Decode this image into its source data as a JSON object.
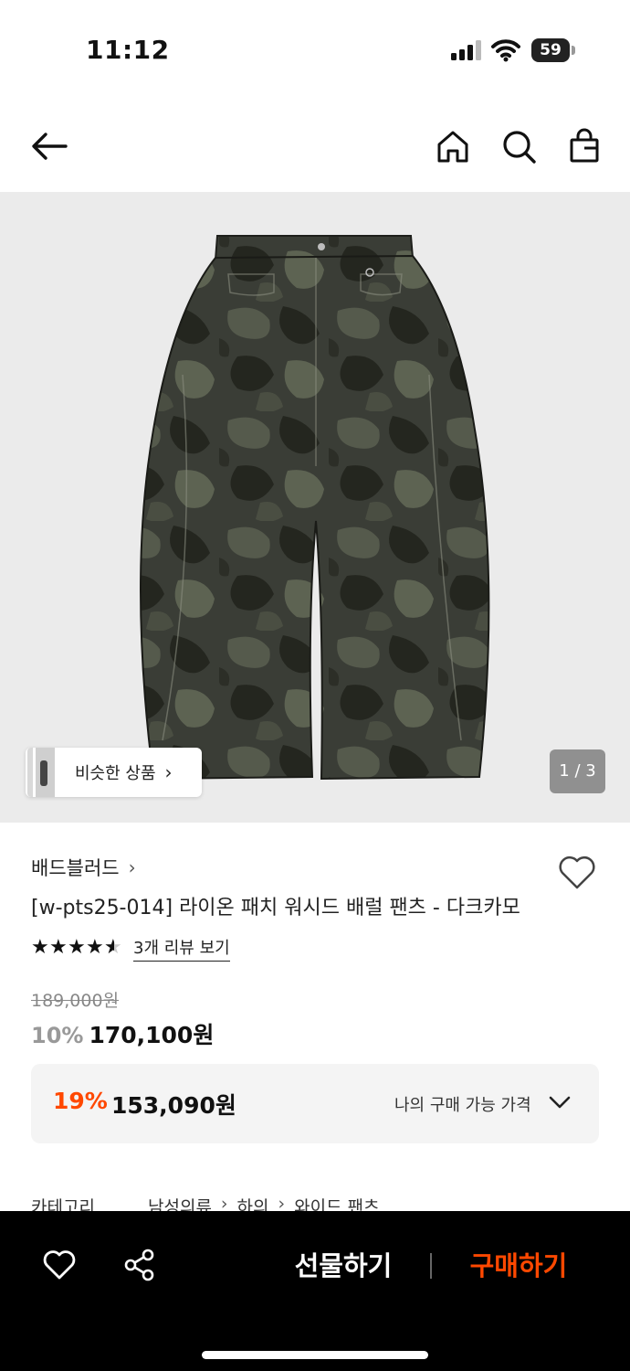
{
  "status_bar": {
    "time": "11:12",
    "battery": "59"
  },
  "nav": {
    "back_icon": "arrow-left-icon",
    "home_icon": "home-icon",
    "search_icon": "search-icon",
    "bag_icon": "shopping-bag-icon"
  },
  "gallery": {
    "similar_label": "비슷한 상품",
    "counter": "1 / 3"
  },
  "product": {
    "brand": "배드블러드",
    "title": "[w-pts25-014] 라이온 패치 워시드 배럴 팬츠 - 다크카모",
    "rating": 4.5,
    "review_link": "3개 리뷰 보기",
    "original_price": "189,000원",
    "discount_percent": "10%",
    "sale_price": "170,100원",
    "my_price": {
      "percent": "19%",
      "price": "153,090원",
      "label": "나의 구매 가능 가격"
    },
    "category": {
      "label": "카테고리",
      "path": [
        "남성의류",
        "하의",
        "와이드 팬츠"
      ]
    }
  },
  "bottom_bar": {
    "gift_label": "선물하기",
    "buy_label": "구매하기"
  },
  "colors": {
    "accent": "#ff4800",
    "image_bg": "#ebebeb",
    "price_box_bg": "#f4f4f4"
  }
}
